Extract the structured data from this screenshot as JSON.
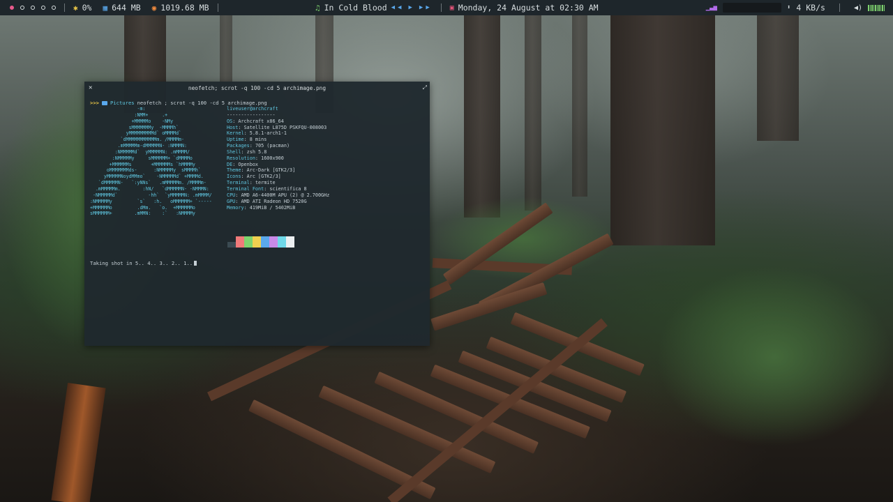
{
  "topbar": {
    "workspaces": [
      {
        "label": "workspace-1",
        "active": true
      },
      {
        "label": "workspace-2",
        "active": false
      },
      {
        "label": "workspace-3",
        "active": false
      },
      {
        "label": "workspace-4",
        "active": false
      },
      {
        "label": "workspace-5",
        "active": false
      }
    ],
    "cpu": "0%",
    "memory": "644 MB",
    "disk": "1019.68 MB",
    "music_title": "In Cold Blood",
    "datetime": "Monday, 24 August at 02:30 AM",
    "net_speed": "4 KB/s",
    "icons": {
      "cpu": "cpu-icon",
      "memory": "memory-icon",
      "disk": "disk-icon",
      "music": "music-note-icon",
      "calendar": "calendar-icon",
      "network": "network-activity-icon",
      "volume": "volume-icon"
    },
    "colors": {
      "active_workspace": "#e85a8c",
      "cpu": "#e8c547",
      "memory": "#5aa8ec",
      "disk": "#f08a3e",
      "music": "#7ed36e",
      "calendar": "#e8557a",
      "network": "#b06be8",
      "volume_bar": "#7ed36e"
    }
  },
  "terminal": {
    "title": "neofetch; scrot -q 100 -cd 5 archimage.png",
    "prompt": {
      "arrows": ">>>",
      "dir": "Pictures",
      "command": "neofetch ; scrot -q 100 -cd 5 archimage.png"
    },
    "ascii_art": "                 -m:\n                :NMM+     .+\n               +MMMMMo    -NMy\n              sMMMMMMMy  -MMMMh`\n             yMMMMMMMMMd` oMMMMd`\n           `dMMMMMMMMMMMm. /MMMMm-\n          .mMMMMMm-dMMMMMN- :NMMMN:\n         :NMMMMMd`  yMMMMMN: .mMMMM/\n        :NMMMMMy     sMMMMMM+ `dMMMMo\n       +MMMMMMs       +MMMMMMs `hMMMMy\n      oMMMMMMMds-      :NMMMMMy  sMMMMh`\n     yMMMMMNoydMMmo`    -NMMMMMd` +MMMMd.\n   `dMMMMMN-   `:yNNs`   .mMMMMMm. /MMMMm-\n  .mMMMMMm.        :hN/   `dMMMMMN- -NMMMN:\n -NMMMMMd`           -hh`  `yMMMMMN: .mMMMM/\n:NMMMMMy         `s`   :h.   oMMMMMM+ `-----\n+MMMMMMo         .dMm.   `o.  +MMMMMMo\nsMMMMMM+        .mMMN:    :`   :NMMMMy",
    "user_host": "liveuser@archcraft",
    "separator": "-----------------",
    "info": [
      {
        "key": "OS",
        "value": "Archcraft x86_64"
      },
      {
        "key": "Host",
        "value": "Satellite L875D PSKFQU-008003"
      },
      {
        "key": "Kernel",
        "value": "5.8.1-arch1-1"
      },
      {
        "key": "Uptime",
        "value": "8 mins"
      },
      {
        "key": "Packages",
        "value": "705 (pacman)"
      },
      {
        "key": "Shell",
        "value": "zsh 5.8"
      },
      {
        "key": "Resolution",
        "value": "1600x900"
      },
      {
        "key": "DE",
        "value": "Openbox"
      },
      {
        "key": "Theme",
        "value": "Arc-Dark [GTK2/3]"
      },
      {
        "key": "Icons",
        "value": "Arc [GTK2/3]"
      },
      {
        "key": "Terminal",
        "value": "termite"
      },
      {
        "key": "Terminal Font",
        "value": "scientifica 8"
      },
      {
        "key": "CPU",
        "value": "AMD A6-4400M APU (2) @ 2.700GHz"
      },
      {
        "key": "GPU",
        "value": "AMD ATI Radeon HD 7520G"
      },
      {
        "key": "Memory",
        "value": "419MiB / 5402MiB"
      }
    ],
    "palette": [
      "#3b4a52",
      "#f07a7a",
      "#7ed36e",
      "#f0d050",
      "#5aa8ec",
      "#c98ae8",
      "#6fd8e8",
      "#eceff1"
    ],
    "countdown": "Taking shot in 5.. 4.. 3.. 2.. 1.."
  }
}
